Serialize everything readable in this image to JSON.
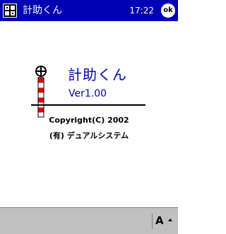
{
  "titlebar": {
    "app_title": "計助くん",
    "time": "17:22",
    "ok_label": "ok"
  },
  "about": {
    "app_name": "計助くん",
    "version": "Ver1.00",
    "copyright": "Copyright(C) 2002",
    "company": "(有) デュアルシステム"
  },
  "cmdbar": {
    "input_letter": "A"
  },
  "colors": {
    "titlebar_bg": "#0000b4",
    "accent_text": "#0000b4",
    "logo_red": "#e00000",
    "cmdbar_bg": "#c0c0c0"
  },
  "icons": {
    "start": "windows-start-icon",
    "logo": "survey-pole-icon",
    "ok": "ok-button-icon",
    "input": "input-panel-icon"
  }
}
